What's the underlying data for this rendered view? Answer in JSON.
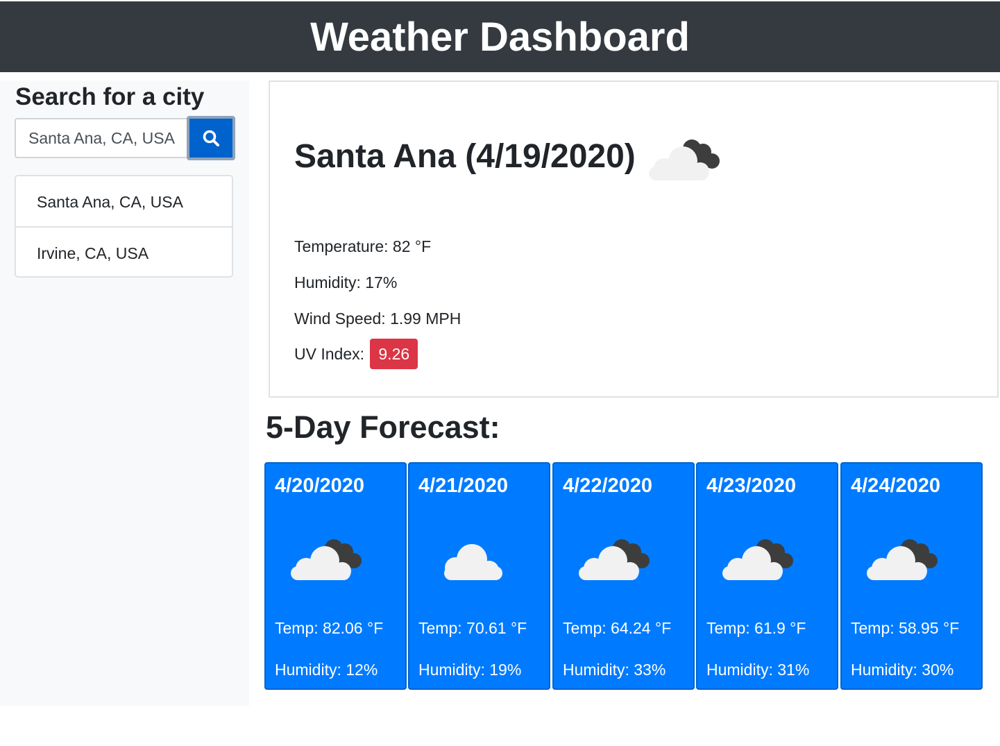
{
  "header": {
    "title": "Weather Dashboard"
  },
  "sidebar": {
    "title": "Search for a city",
    "search": {
      "value": "Santa Ana, CA, USA",
      "button_icon": "search-icon"
    },
    "history": [
      {
        "label": "Santa Ana, CA, USA"
      },
      {
        "label": "Irvine, CA, USA"
      }
    ]
  },
  "current": {
    "title": "Santa Ana (4/19/2020)",
    "icon": "partly-cloudy-icon",
    "temperature": "Temperature: 82 °F",
    "humidity": "Humidity: 17%",
    "wind": "Wind Speed: 1.99 MPH",
    "uv_label": "UV Index:",
    "uv_value": "9.26",
    "uv_color": "#dc3545"
  },
  "forecast": {
    "title": "5-Day Forecast:",
    "card_color": "#007bff",
    "days": [
      {
        "date": "4/20/2020",
        "icon": "partly-cloudy-icon",
        "temp": "Temp: 82.06 °F",
        "humidity": "Humidity: 12%"
      },
      {
        "date": "4/21/2020",
        "icon": "cloud-icon",
        "temp": "Temp: 70.61 °F",
        "humidity": "Humidity: 19%"
      },
      {
        "date": "4/22/2020",
        "icon": "partly-cloudy-icon",
        "temp": "Temp: 64.24 °F",
        "humidity": "Humidity: 33%"
      },
      {
        "date": "4/23/2020",
        "icon": "partly-cloudy-icon",
        "temp": "Temp: 61.9 °F",
        "humidity": "Humidity: 31%"
      },
      {
        "date": "4/24/2020",
        "icon": "partly-cloudy-icon",
        "temp": "Temp: 58.95 °F",
        "humidity": "Humidity: 30%"
      }
    ]
  }
}
